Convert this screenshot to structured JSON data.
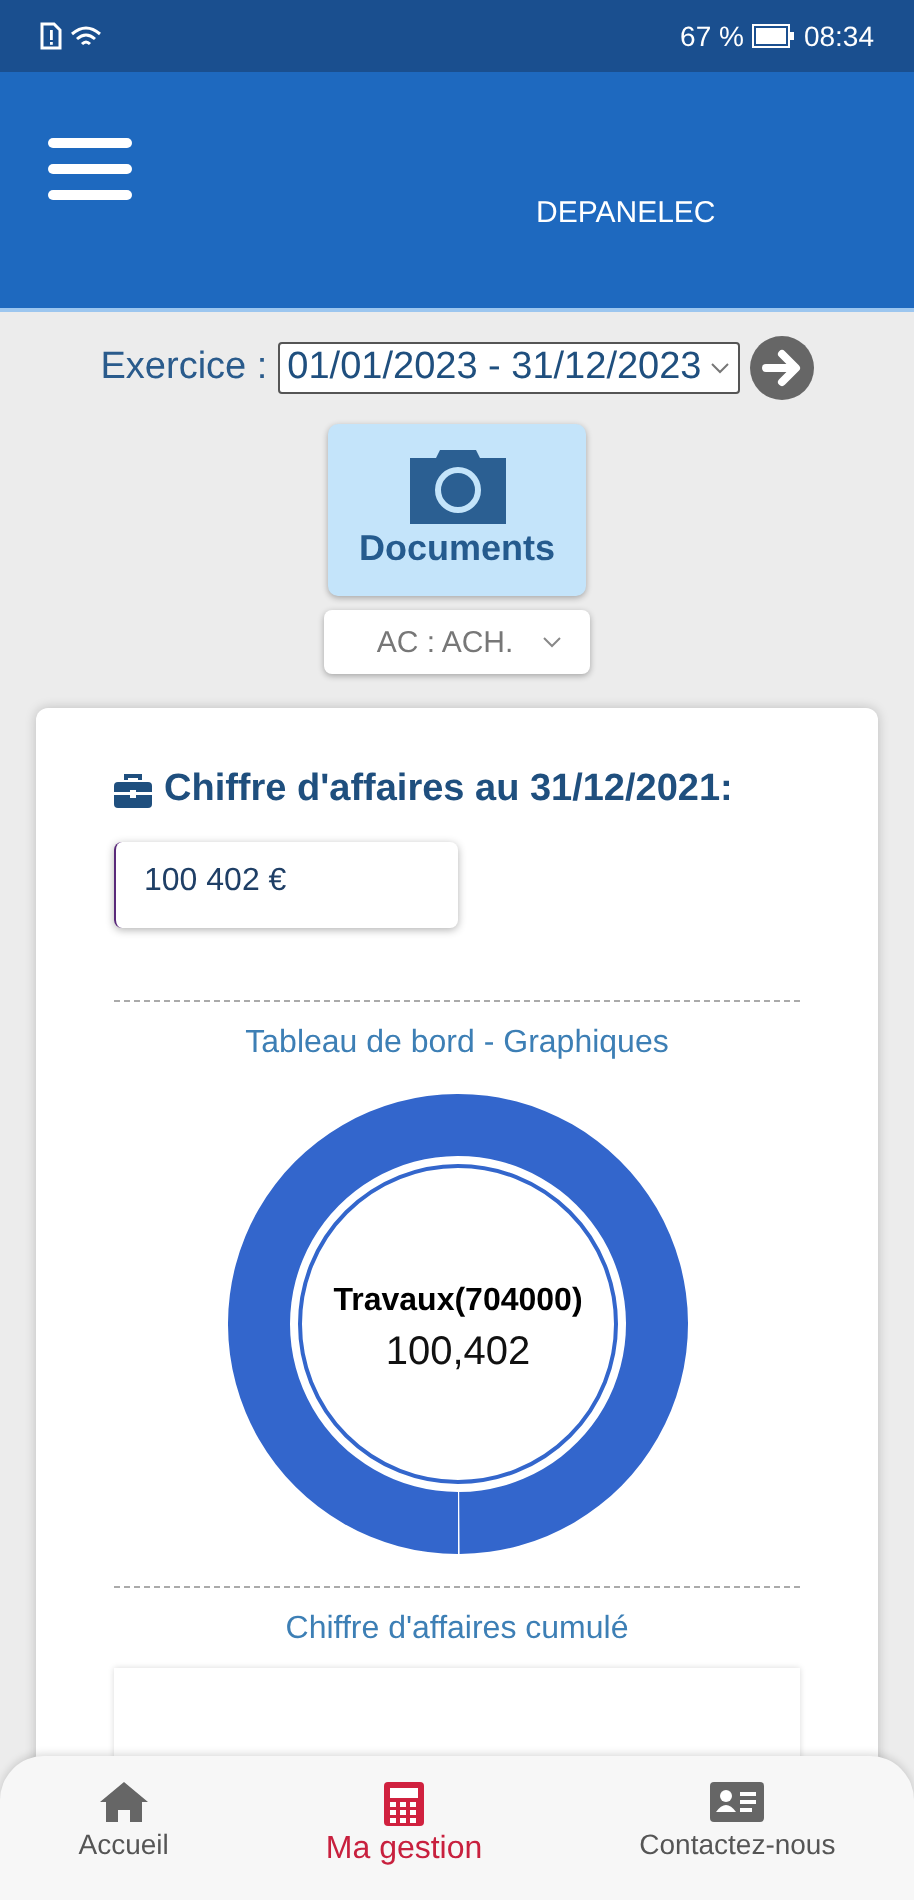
{
  "status_bar": {
    "battery": "67 %",
    "time": "08:34"
  },
  "header": {
    "title": "DEPANELEC"
  },
  "exercise": {
    "label": "Exercice :",
    "value": "01/01/2023 - 31/12/2023"
  },
  "documents_button": {
    "label": "Documents"
  },
  "journal_select": {
    "value": "AC : ACH."
  },
  "revenue": {
    "title": "Chiffre d'affaires au 31/12/2021:",
    "value": "100 402 €"
  },
  "dashboard": {
    "title": "Tableau de bord - Graphiques",
    "center_label": "Travaux(704000)",
    "center_value": "100,402"
  },
  "cumulative": {
    "title": "Chiffre d'affaires cumulé"
  },
  "bottom_nav": [
    {
      "label": "Accueil",
      "kind": "home",
      "selected": false
    },
    {
      "label": "Ma gestion",
      "kind": "calculator",
      "selected": true
    },
    {
      "label": "Contactez-nous",
      "kind": "contact",
      "selected": false
    }
  ]
}
